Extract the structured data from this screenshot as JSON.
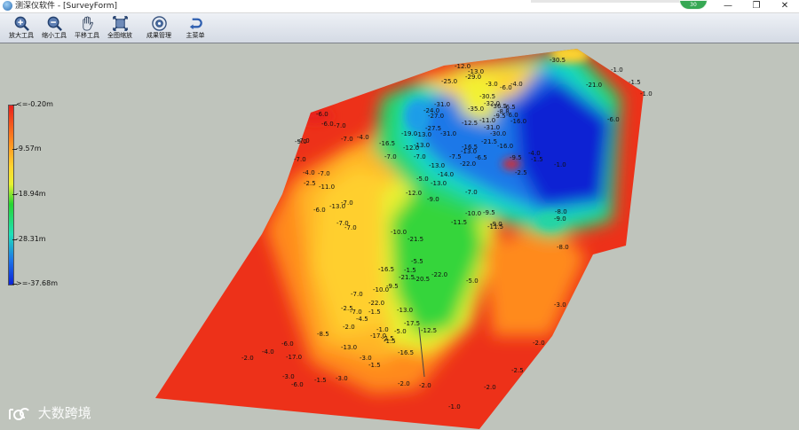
{
  "window": {
    "title": "测深仪软件 - [SurveyForm]",
    "badge": "30",
    "minimize": "—",
    "maximize": "❐",
    "close": "✕"
  },
  "toolbar": {
    "buttons": [
      {
        "label": "放大工具",
        "icon": "zoom-in-icon"
      },
      {
        "label": "缩小工具",
        "icon": "zoom-out-icon"
      },
      {
        "label": "平移工具",
        "icon": "hand-pan-icon"
      },
      {
        "label": "全图缩放",
        "icon": "full-extent-icon"
      },
      {
        "label": "成果管理",
        "icon": "results-management-icon"
      },
      {
        "label": "主菜单",
        "icon": "return-icon"
      }
    ]
  },
  "legend": {
    "labels": [
      "<=-0.20m",
      "-9.57m",
      "-18.94m",
      "-28.31m",
      ">=-37.68m"
    ],
    "colors": [
      "#e8201c",
      "#ff8b1e",
      "#ffd42f",
      "#27d631",
      "#1ee0b8",
      "#1e77e8",
      "#0b22d6"
    ]
  },
  "depth_labels": [
    "-12.0",
    "-13.0",
    "-30.5",
    "-1.0",
    "-1.5",
    "-1.0",
    "-25.0",
    "-29.0",
    "-3.0",
    "-6.0",
    "-4.0",
    "-21.0",
    "-31.0",
    "-30.5",
    "-32.0",
    "-24.0",
    "-27.0",
    "-35.0",
    "-36.5",
    "-9.5",
    "-8.8",
    "-6.5",
    "-6.0",
    "-16.0",
    "-12.5",
    "-11.0",
    "-31.0",
    "-30.0",
    "-21.5",
    "-6.0",
    "-27.5",
    "-31.0",
    "-16.0",
    "-13.0",
    "-16.5",
    "-19.0",
    "-13.0",
    "-4.0",
    "-1.5",
    "-1.0",
    "-7.5",
    "-6.5",
    "-9.5",
    "-13.0",
    "-12.0",
    "-16.5",
    "-13.0",
    "-7.0",
    "-14.0",
    "-2.5",
    "-7.0",
    "-7.0",
    "-6.0",
    "-7.0",
    "-6.0",
    "-4.0",
    "-7.0",
    "-7.0",
    "-9.0",
    "-4.0",
    "-7.0",
    "-7.0",
    "-5.0",
    "-13.0",
    "-12.0",
    "-10.0",
    "-11.0",
    "-9.0",
    "-13.0",
    "-6.0",
    "-7.0",
    "-2.5",
    "-9.0",
    "-11.5",
    "-9.5",
    "-7.0",
    "-7.0",
    "-9.0",
    "-10.0",
    "-8.0",
    "-21.5",
    "-11.5",
    "-22.0",
    "-5.0",
    "-16.5",
    "-22.0",
    "-8.0",
    "-21.5",
    "-3.0",
    "-7.0",
    "-10.0",
    "-5.5",
    "-22.0",
    "-9.5",
    "-1.5",
    "-20.5",
    "-12.5",
    "-1.5",
    "-13.0",
    "-17.5",
    "-2.5",
    "-1.0",
    "-4.5",
    "-7.0",
    "-2.0",
    "-2.5",
    "-13.0",
    "-17.0",
    "-1.5",
    "-5.0",
    "-16.5",
    "-3.0",
    "-1.5",
    "-8.5",
    "-17.0",
    "-6.0",
    "-4.0",
    "-2.0",
    "-3.0",
    "-6.0",
    "-1.5",
    "-3.0",
    "-2.0",
    "-2.0",
    "-2.0",
    "-2.5",
    "-2.0",
    "-1.0"
  ],
  "watermark": {
    "text": "大数跨境"
  }
}
